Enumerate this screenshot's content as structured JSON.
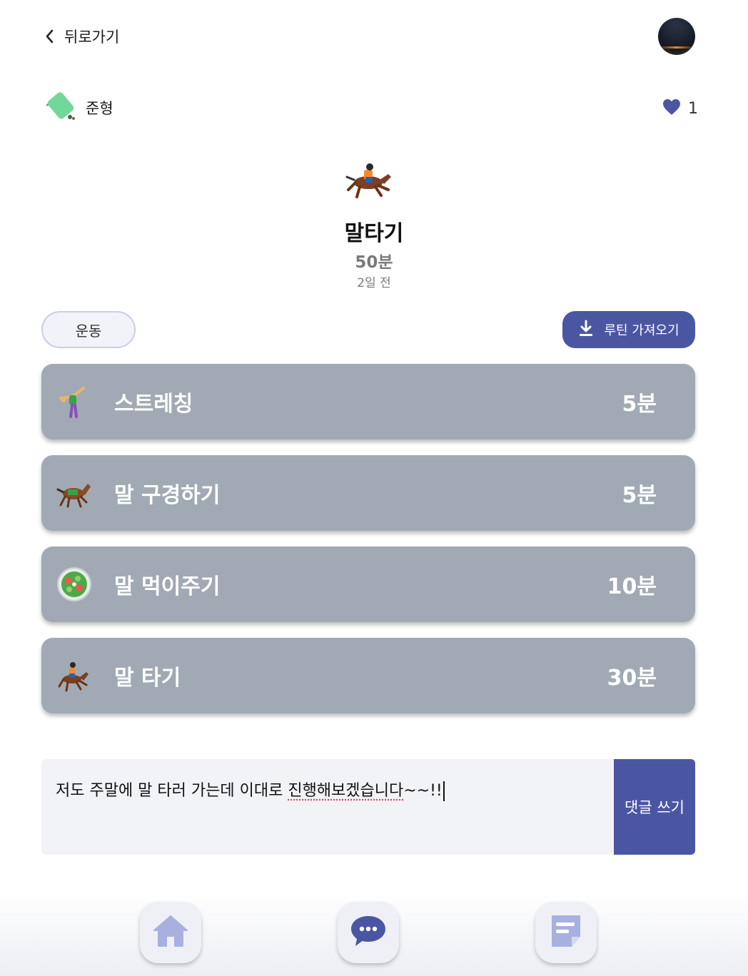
{
  "header": {
    "back_label": "뒤로가기"
  },
  "author": {
    "name": "준형",
    "likes": "1"
  },
  "routine": {
    "title": "말타기",
    "duration": "50분",
    "posted": "2일 전",
    "category": "운동",
    "import_label": "루틴 가져오기"
  },
  "exercises": [
    {
      "name": "스트레칭",
      "time": "5분",
      "icon": "cartwheel-emoji"
    },
    {
      "name": "말 구경하기",
      "time": "5분",
      "icon": "horse-emoji"
    },
    {
      "name": "말 먹이주기",
      "time": "10분",
      "icon": "salad-emoji"
    },
    {
      "name": "말 타기",
      "time": "30분",
      "icon": "horse-racing-emoji"
    }
  ],
  "comment": {
    "text_before": "저도 주말에 말 타러 가는데 이대로 ",
    "text_typo": "진행해보겠습니다",
    "text_after": "~~!!",
    "submit_label": "댓글 쓰기"
  },
  "nav": [
    {
      "icon": "home-icon"
    },
    {
      "icon": "chat-icon"
    },
    {
      "icon": "note-icon"
    }
  ],
  "colors": {
    "accent": "#4b56a3",
    "card": "#a1aab4",
    "heart": "#4b56a3"
  }
}
